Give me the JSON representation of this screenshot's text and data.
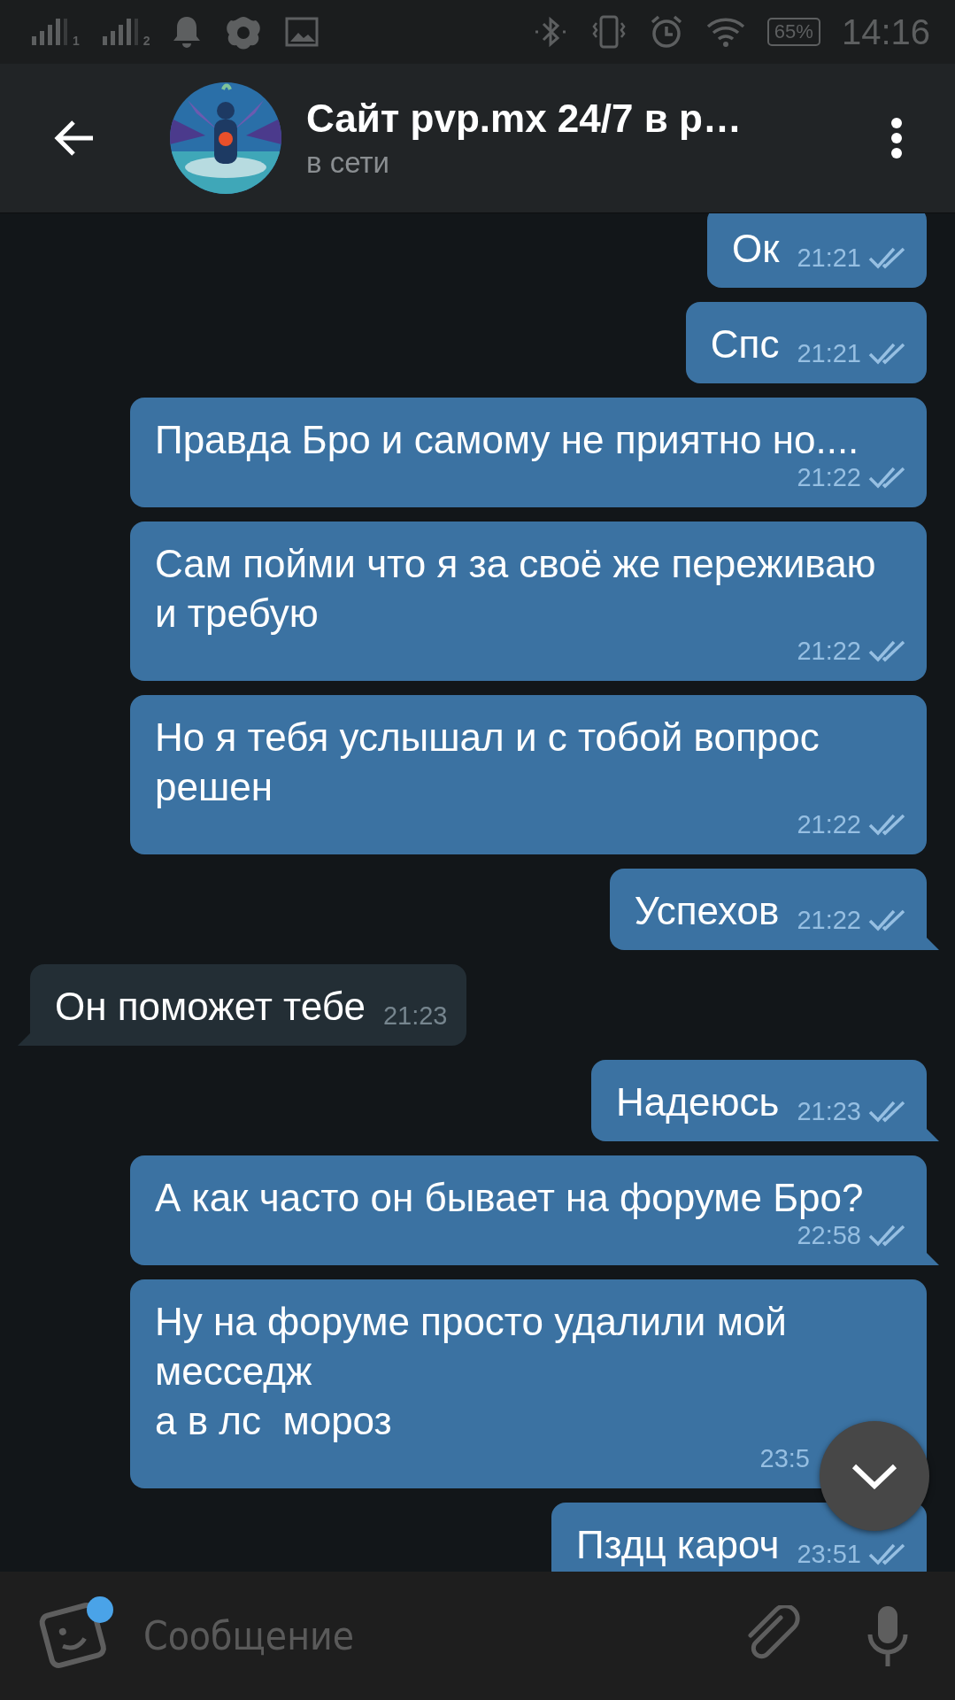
{
  "status_bar": {
    "sims": [
      "1",
      "2"
    ],
    "battery": "65%",
    "time": "14:16"
  },
  "header": {
    "title": "Сайт pvp.mx 24/7 в р…",
    "subtitle": "в сети"
  },
  "messages": [
    {
      "kind": "outgoing",
      "text": "Ок",
      "time": "21:21",
      "read": true,
      "tail": false
    },
    {
      "kind": "outgoing",
      "text": "Спс",
      "time": "21:21",
      "read": true,
      "tail": false
    },
    {
      "kind": "outgoing",
      "text": "Правда Бро и самому не приятно но....",
      "time": "21:22",
      "read": true,
      "tail": false
    },
    {
      "kind": "outgoing",
      "text": "Сам пойми что я за своё же переживаю и требую",
      "time": "21:22",
      "read": true,
      "tail": false
    },
    {
      "kind": "outgoing",
      "text": "Но я тебя услышал и с тобой вопрос решен",
      "time": "21:22",
      "read": true,
      "tail": false
    },
    {
      "kind": "outgoing",
      "text": "Успехов",
      "time": "21:22",
      "read": true,
      "tail": true
    },
    {
      "kind": "incoming",
      "text": "Он поможет тебе",
      "time": "21:23",
      "tail": true
    },
    {
      "kind": "outgoing",
      "text": "Надеюсь",
      "time": "21:23",
      "read": true,
      "tail": true
    },
    {
      "kind": "outgoing",
      "text": "А как часто он бывает на форуме Бро?",
      "time": "22:58",
      "read": true,
      "tail": true
    },
    {
      "kind": "outgoing",
      "text": "Ну на форуме просто удалили мой месседж\nа в лс  мороз",
      "time": "23:5"
    },
    {
      "kind": "outgoing",
      "text": "Пздц кароч",
      "time": "23:51",
      "read": true,
      "tail": false
    }
  ],
  "input": {
    "placeholder": "Сообщение",
    "emoji_badge": true
  }
}
